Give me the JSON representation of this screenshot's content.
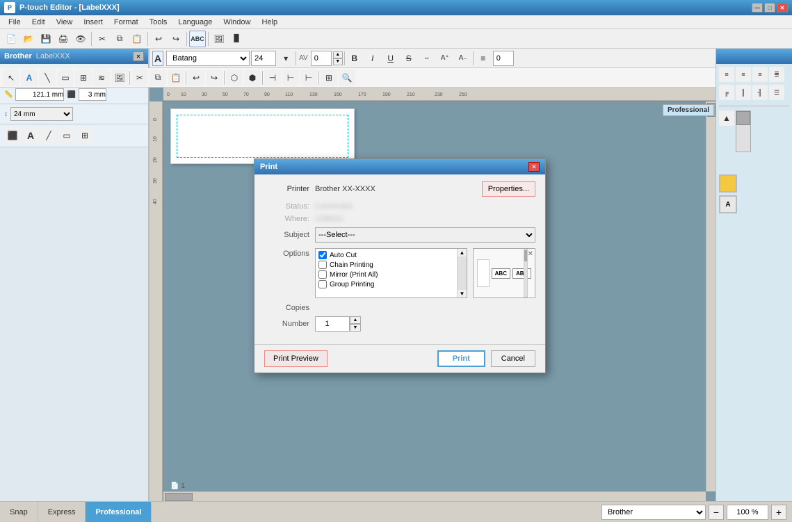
{
  "app": {
    "title": "P-touch Editor - [LabelXXX]",
    "icon": "P"
  },
  "titlebar": {
    "title": "P-touch Editor - [LabelXXX]",
    "minimize": "—",
    "maximize": "□",
    "close": "✕"
  },
  "menubar": {
    "items": [
      "File",
      "Edit",
      "View",
      "Insert",
      "Format",
      "Tools",
      "Language",
      "Window",
      "Help"
    ]
  },
  "toolbar1": {
    "buttons": [
      "new",
      "open",
      "save",
      "print",
      "preview",
      "cut",
      "copy",
      "paste",
      "undo",
      "redo"
    ]
  },
  "leftpanel": {
    "title": "Brother",
    "subtitle": "LabelXXX",
    "printer_label": "Brother",
    "size_label": "24 mm"
  },
  "toolbar_font": {
    "font_name": "Batang",
    "font_size": "24",
    "bold": "B",
    "italic": "I",
    "underline": "U",
    "strikethrough": "S",
    "align_left": "≡",
    "spacing_value": "0"
  },
  "canvas": {
    "zoom": "100 %",
    "printer": "Brother"
  },
  "statusbar": {
    "snap_label": "Snap",
    "express_label": "Express",
    "professional_label": "Professional",
    "zoom_label": "100 %",
    "printer_label": "Brother"
  },
  "modal": {
    "title": "Print",
    "printer_label": "Printer",
    "printer_name": "Brother XX-XXXX",
    "printer_button": "Properties...",
    "copies_count_label": "Copies",
    "number_label": "Number",
    "number_value": "1",
    "subject_label": "Subject",
    "options_label": "Options",
    "checklist": [
      {
        "id": 1,
        "label": "Auto Cut",
        "checked": true
      },
      {
        "id": 2,
        "label": "Chain Printing",
        "checked": false
      },
      {
        "id": 3,
        "label": "Mirror (Print All)",
        "checked": false
      },
      {
        "id": 4,
        "label": "Group Printing",
        "checked": false
      }
    ],
    "preview_items": [
      "ABC",
      "ABC"
    ],
    "print_preview_btn": "Print Preview",
    "print_btn": "Print",
    "cancel_btn": "Cancel",
    "subject_placeholder": "---Select---",
    "properties_btn": "Properties..."
  },
  "colors": {
    "accent": "#4a9fd4",
    "dialog_border": "#888",
    "active_tab": "#4a9fd4"
  }
}
